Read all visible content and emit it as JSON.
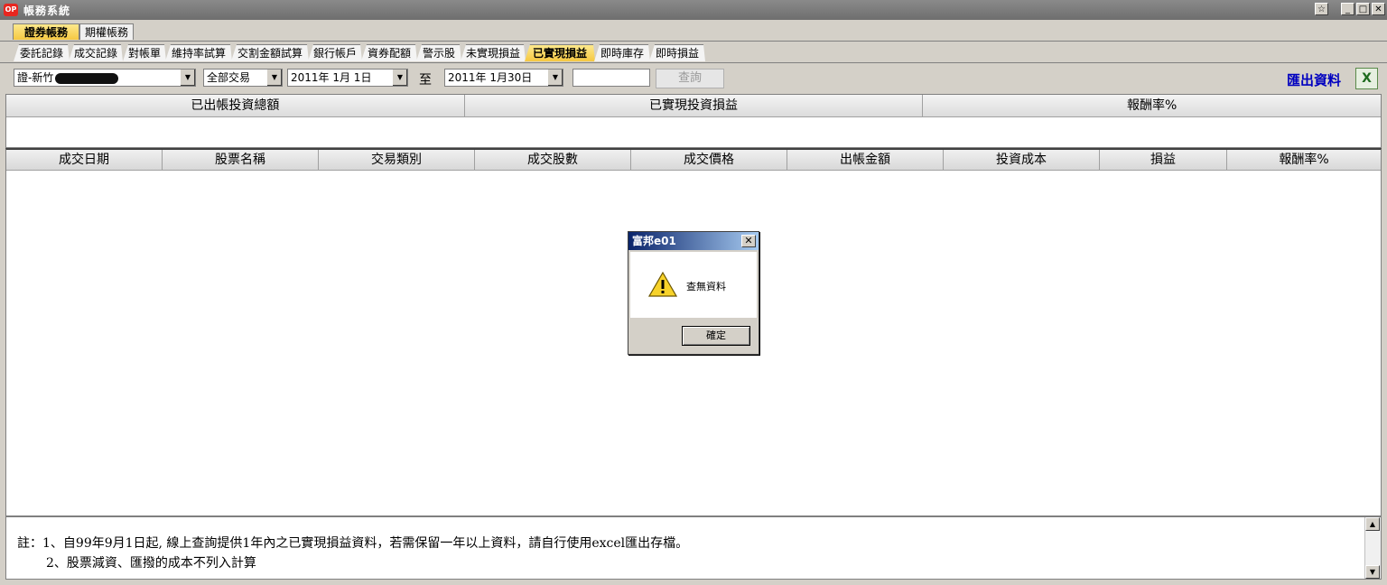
{
  "window": {
    "title": "帳務系統",
    "logo_text": "OP"
  },
  "main_tabs": [
    {
      "label": "證券帳務",
      "active": true
    },
    {
      "label": "期權帳務",
      "active": false
    }
  ],
  "sub_tabs": [
    {
      "label": "委託記錄"
    },
    {
      "label": "成交記錄"
    },
    {
      "label": "對帳單"
    },
    {
      "label": "維持率試算"
    },
    {
      "label": "交割金額試算"
    },
    {
      "label": "銀行帳戶"
    },
    {
      "label": "資券配額"
    },
    {
      "label": "警示股"
    },
    {
      "label": "未實現損益"
    },
    {
      "label": "已實現損益",
      "active": true
    },
    {
      "label": "即時庫存"
    },
    {
      "label": "即時損益"
    }
  ],
  "toolbar": {
    "account_value": "證-新竹",
    "trade_type_value": "全部交易",
    "date_from": "2011年 1月 1日",
    "to_label": "至",
    "date_to": "2011年 1月30日",
    "query_label": "查詢",
    "export_label": "匯出資料"
  },
  "summary": {
    "headers": [
      "已出帳投資總額",
      "已實現投資損益",
      "報酬率%"
    ]
  },
  "detail": {
    "headers": [
      "成交日期",
      "股票名稱",
      "交易類別",
      "成交股數",
      "成交價格",
      "出帳金額",
      "投資成本",
      "損益",
      "報酬率%"
    ]
  },
  "note": {
    "line1": "註：1、自99年9月1日起, 線上查詢提供1年內之已實現損益資料，若需保留一年以上資料，請自行使用excel匯出存檔。",
    "line2": "2、股票減資、匯撥的成本不列入計算"
  },
  "dialog": {
    "title": "富邦e01",
    "message": "查無資料",
    "ok_label": "確定"
  }
}
